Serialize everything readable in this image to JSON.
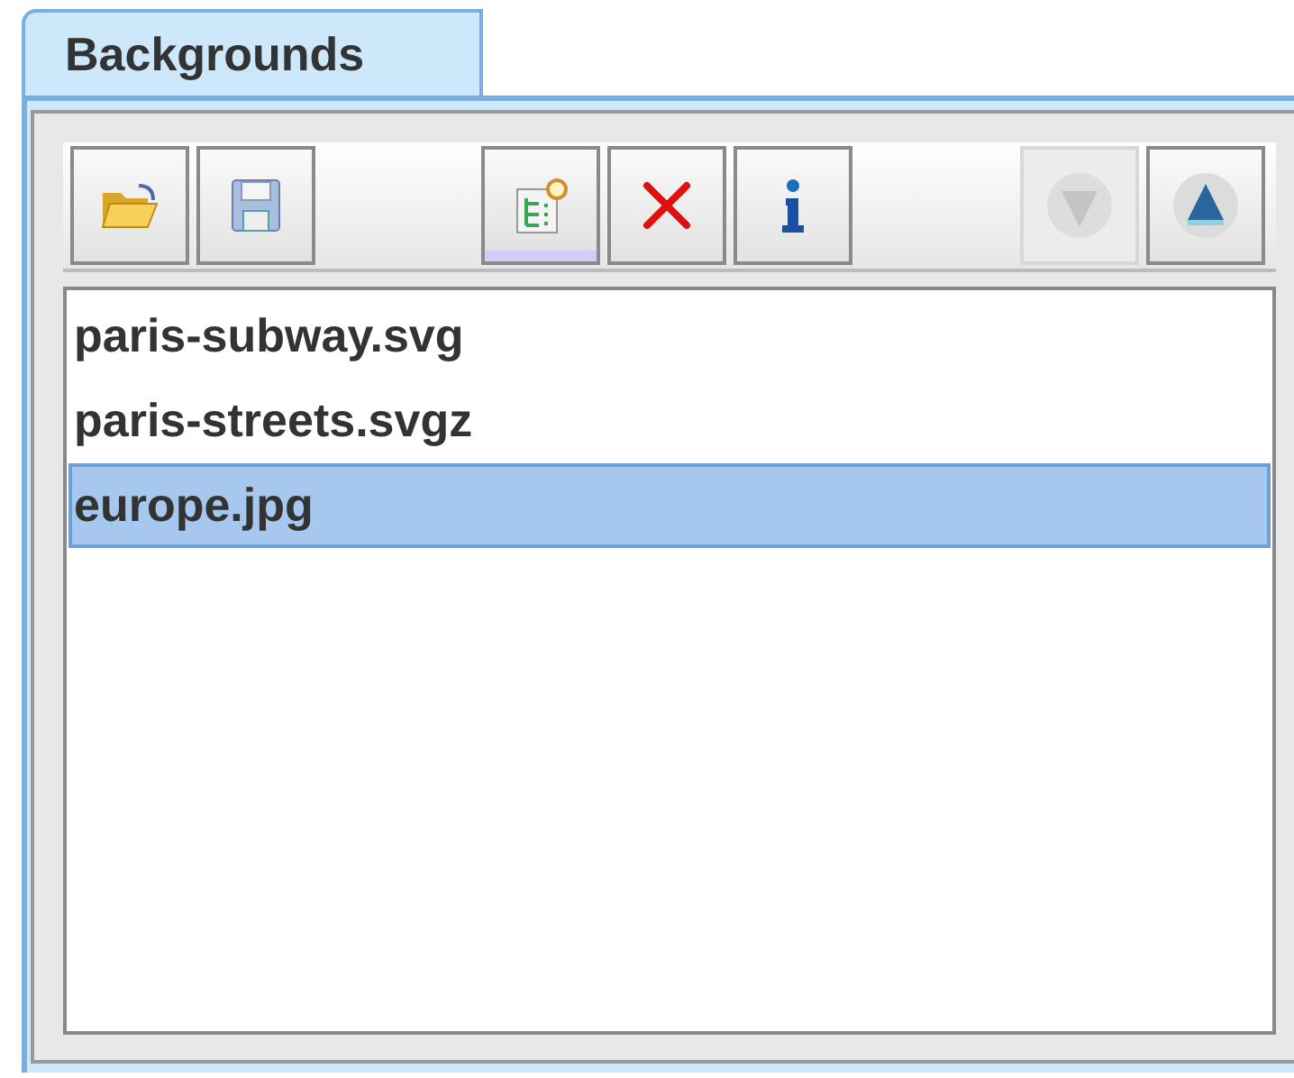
{
  "tab": {
    "label": "Backgrounds",
    "selected": true
  },
  "toolbar": {
    "groups": [
      [
        {
          "kind": "open",
          "disabled": false,
          "pressed": false
        },
        {
          "kind": "save",
          "disabled": false,
          "pressed": false
        }
      ],
      [
        {
          "kind": "new",
          "disabled": false,
          "pressed": true
        },
        {
          "kind": "delete",
          "disabled": false,
          "pressed": false
        },
        {
          "kind": "info",
          "disabled": false,
          "pressed": false
        }
      ],
      [
        {
          "kind": "down",
          "disabled": true,
          "pressed": false
        },
        {
          "kind": "up",
          "disabled": false,
          "pressed": false
        }
      ]
    ]
  },
  "files": [
    {
      "name": "paris-subway.svg",
      "selected": false
    },
    {
      "name": "paris-streets.svgz",
      "selected": false
    },
    {
      "name": "europe.jpg",
      "selected": true
    }
  ]
}
